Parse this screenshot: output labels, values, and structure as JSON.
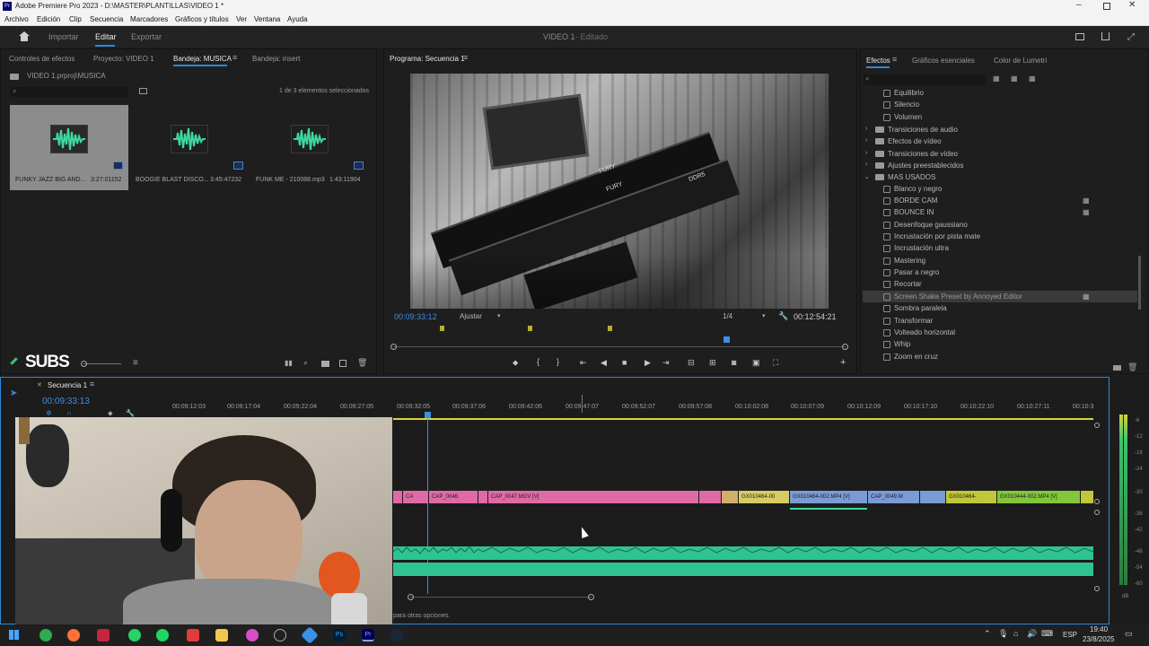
{
  "app": {
    "title": "Adobe Premiere Pro 2023 - D:\\MASTER\\PLANTILLAS\\VIDEO 1 *",
    "logo": "Pr"
  },
  "menu": [
    "Archivo",
    "Edición",
    "Clip",
    "Secuencia",
    "Marcadores",
    "Gráficos y títulos",
    "Ver",
    "Ventana",
    "Ayuda"
  ],
  "workspace": {
    "tabs": [
      "Importar",
      "Editar",
      "Exportar"
    ],
    "active": "Editar",
    "center_title": "VIDEO 1",
    "center_status": "- Editado"
  },
  "project_panel": {
    "tabs": [
      "Controles de efectos",
      "Proyecto: VIDEO 1",
      "Bandeja: MUSICA",
      "Bandeja: insert"
    ],
    "path": "VIDEO 1.prproj\\MUSICA",
    "selection_status": "1 de 3 elementos seleccionados",
    "items": [
      {
        "name": "FUNKY JAZZ BIG AND...",
        "duration": "3:27:01152"
      },
      {
        "name": "BOOGIE BLAST DISCO...",
        "duration": "3:45:47232"
      },
      {
        "name": "FUNK ME - 210088.mp3",
        "duration": "1:43:11904"
      }
    ]
  },
  "overlay": {
    "subs_label": "SUBS"
  },
  "program_monitor": {
    "tab": "Programa: Secuencia 1",
    "timecode": "00:09:33:12",
    "fit": "Ajustar",
    "resolution": "1/4",
    "duration": "00:12:54:21",
    "image_text": [
      "FURY",
      "FURY",
      "DDR5"
    ]
  },
  "effects_panel": {
    "tabs": [
      "Efectos",
      "Gráficos esenciales",
      "Color de Lumetri"
    ],
    "items": [
      {
        "label": "Equilibrio",
        "kind": "effect"
      },
      {
        "label": "Silencio",
        "kind": "effect"
      },
      {
        "label": "Volumen",
        "kind": "effect"
      },
      {
        "label": "Transiciones de audio",
        "kind": "folder"
      },
      {
        "label": "Efectos de vídeo",
        "kind": "folder"
      },
      {
        "label": "Transiciones de vídeo",
        "kind": "folder"
      },
      {
        "label": "Ajustes preestablecidos",
        "kind": "folder"
      },
      {
        "label": "MAS USADOS",
        "kind": "folder-open"
      },
      {
        "label": "Blanco y negro",
        "kind": "effect"
      },
      {
        "label": "BORDE CAM",
        "kind": "effect"
      },
      {
        "label": "BOUNCE IN",
        "kind": "effect"
      },
      {
        "label": "Desenfoque gaussiano",
        "kind": "effect"
      },
      {
        "label": "Incrustación por pista mate",
        "kind": "effect"
      },
      {
        "label": "Incrustación ultra",
        "kind": "effect"
      },
      {
        "label": "Mastering",
        "kind": "effect"
      },
      {
        "label": "Pasar a negro",
        "kind": "effect"
      },
      {
        "label": "Recortar",
        "kind": "effect"
      },
      {
        "label": "Screen Shake Preset by Annoyed Editor",
        "kind": "effect"
      },
      {
        "label": "Sombra paralela",
        "kind": "effect"
      },
      {
        "label": "Transformar",
        "kind": "effect"
      },
      {
        "label": "Volteado horizontal",
        "kind": "effect"
      },
      {
        "label": "Whip",
        "kind": "effect"
      },
      {
        "label": "Zoom en cruz",
        "kind": "effect"
      }
    ]
  },
  "timeline": {
    "tab": "Secuencia 1",
    "timecode": "00:09:33:13",
    "ruler": [
      "00:09:12:03",
      "00:09:17:04",
      "00:09:22:04",
      "00:09:27:05",
      "00:09:32:05",
      "00:09:37:06",
      "00:09:42:06",
      "00:09:47:07",
      "00:09:52:07",
      "00:09:57:08",
      "00:10:02:08",
      "00:10:07:09",
      "00:10:12:09",
      "00:10:17:10",
      "00:10:22:10",
      "00:10:27:11",
      "00:10:3"
    ],
    "clips": [
      "CA",
      "CAP_0046.",
      "CAP_0047.MOV [V]",
      "GX010464-00",
      "GX010464-002.MP4 [V]",
      "CAP_0049.M",
      "GX010464-",
      "GX010444-002.MP4 [V]"
    ],
    "status_text": "para otras opciones.",
    "vu_labels": [
      "-6",
      "-12",
      "-18",
      "-24",
      "-30",
      "-36",
      "-42",
      "-48",
      "-54",
      "-60",
      "dB"
    ]
  },
  "taskbar": {
    "lang": "ESP",
    "time": "19:40",
    "date": "23/8/2025"
  }
}
